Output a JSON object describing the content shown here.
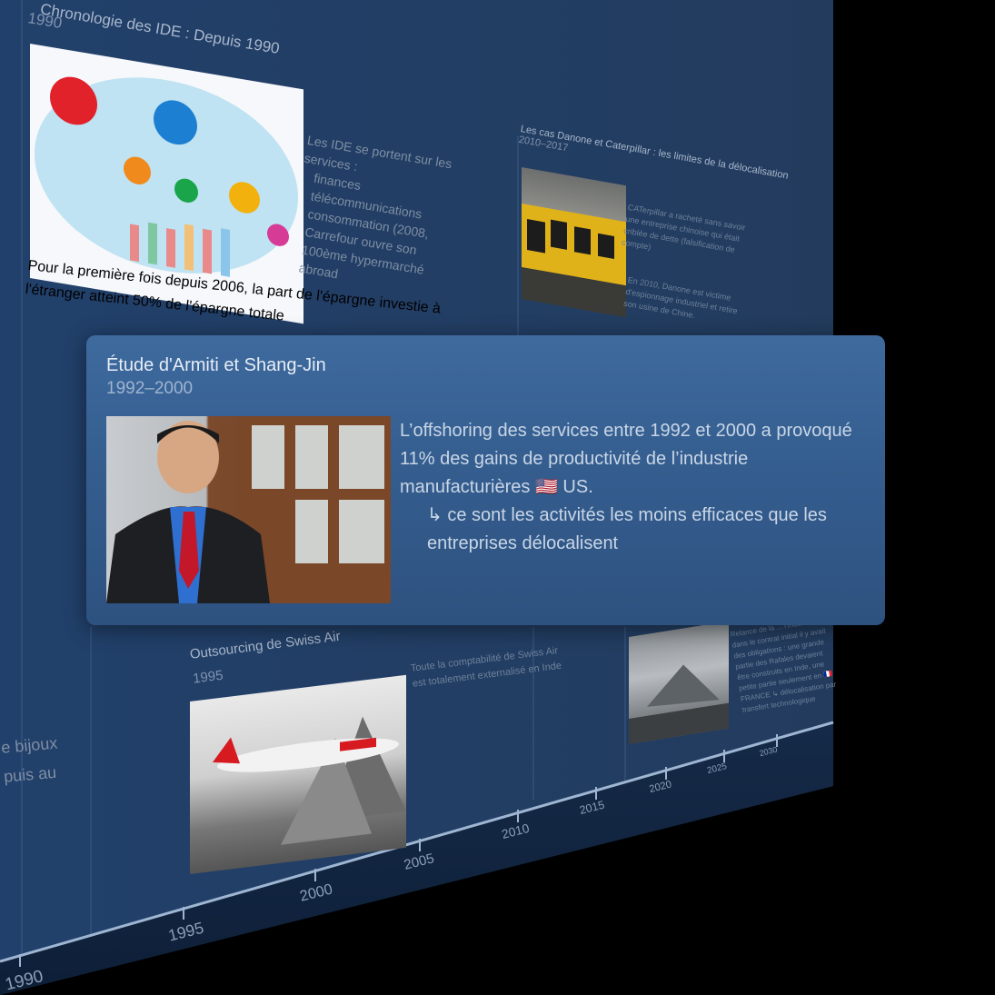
{
  "colors": {
    "background": "#000000",
    "wall": "#22406a",
    "focus_card": "#3a6598",
    "axis_line": "#9fb6d3"
  },
  "timeline": {
    "axis_years": [
      "1990",
      "1995",
      "2000",
      "2005",
      "2010",
      "2015",
      "2020",
      "2025",
      "2030"
    ]
  },
  "cards": {
    "ide": {
      "title": "Chronologie des IDE : Depuis 1990",
      "year": "1990",
      "services_intro": "Les IDE se portent sur les services :",
      "services": [
        "finances",
        "télécommunications",
        "consommation (2008, Carrefour ouvre son 100ème hypermarché abroad"
      ],
      "summary": "Pour la première fois depuis 2006, la part de l'épargne investie à l'étranger atteint 50% de l'épargne totale"
    },
    "danone": {
      "title": "Les cas Danone et Caterpillar : les limites de la délocalisation",
      "year": "2010–2017",
      "text1": "CATerpillar a racheté sans savoir une entreprise chinoise qui était criblée de dette (falsification de compte)",
      "text2": "En 2010, Danone est victime d'espionnage industriel et retire son usine de Chine."
    },
    "swissair": {
      "title": "Outsourcing de Swiss Air",
      "year": "1995",
      "text": "Toute la comptabilité de Swiss Air est totalement externalisé en Inde"
    },
    "rafale": {
      "text": "Relance de la ... l'Inde. Mais dans le contrat initial il y avait des obligations : une grande partie des Rafales devaient être construits en Inde, une petite partie seulement en 🇫🇷 FRANCE ↳ délocalisation par transfert technologique"
    },
    "left_partial": {
      "line1": "e bijoux",
      "line2": "puis au"
    }
  },
  "focus": {
    "title": "Étude d'Armiti et Shang-Jin",
    "year": "1992–2000",
    "line1": "L’offshoring des services entre 1992 et 2000 a provoqué 11% des gains de productivité de l’industrie manufacturières 🇺🇸 US.",
    "line2": "↳ ce sont les activités les moins efficaces que les entreprises délocalisent"
  }
}
